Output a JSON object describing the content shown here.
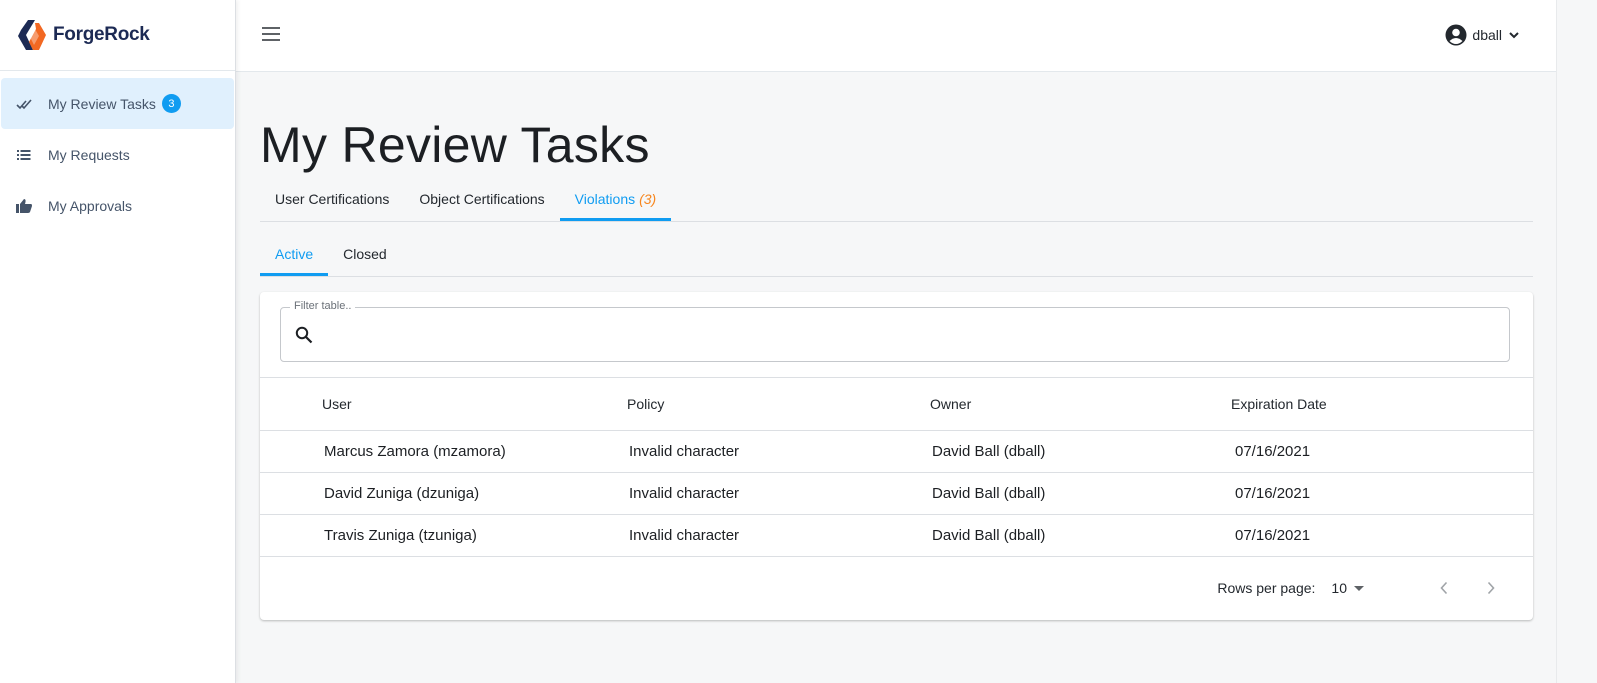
{
  "app": {
    "brand": "ForgeRock",
    "colors": {
      "accent": "#109cf1",
      "count": "#f7861e",
      "brand_dark": "#1c2a54",
      "brand_orange": "#f26822"
    }
  },
  "sidebar": {
    "items": [
      {
        "label": "My Review Tasks",
        "icon": "double-check-icon",
        "badge": "3",
        "active": true
      },
      {
        "label": "My Requests",
        "icon": "list-icon",
        "active": false
      },
      {
        "label": "My Approvals",
        "icon": "thumbs-up-icon",
        "active": false
      }
    ]
  },
  "header": {
    "menu_icon": "hamburger-menu-icon",
    "username": "dball",
    "avatar_icon": "account-circle-icon",
    "dropdown_icon": "chevron-down-icon"
  },
  "main": {
    "title": "My Review Tasks",
    "tabs": [
      {
        "label": "User Certifications",
        "active": false
      },
      {
        "label": "Object Certifications",
        "active": false
      },
      {
        "label": "Violations",
        "count": "(3)",
        "active": true
      }
    ],
    "subtabs": [
      {
        "label": "Active",
        "active": true
      },
      {
        "label": "Closed",
        "active": false
      }
    ],
    "filter": {
      "label": "Filter table..",
      "value": "",
      "icon": "search-icon"
    },
    "table": {
      "columns": [
        "User",
        "Policy",
        "Owner",
        "Expiration Date"
      ],
      "rows": [
        [
          "Marcus Zamora (mzamora)",
          "Invalid character",
          "David Ball (dball)",
          "07/16/2021"
        ],
        [
          "David Zuniga (dzuniga)",
          "Invalid character",
          "David Ball (dball)",
          "07/16/2021"
        ],
        [
          "Travis Zuniga (tzuniga)",
          "Invalid character",
          "David Ball (dball)",
          "07/16/2021"
        ]
      ]
    },
    "pagination": {
      "rows_per_page_label": "Rows per page:",
      "rows_per_page_value": "10",
      "prev_icon": "chevron-left-icon",
      "next_icon": "chevron-right-icon"
    }
  }
}
